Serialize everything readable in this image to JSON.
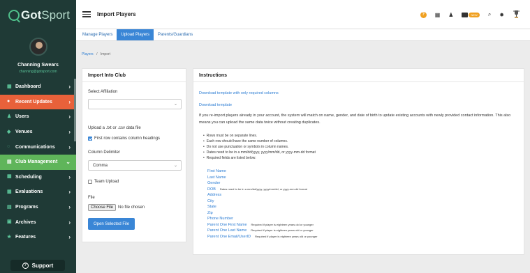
{
  "logo": {
    "part1": "Got",
    "part2": "Sport"
  },
  "user": {
    "name": "Channing Swears",
    "email": "channing@gotsport.com"
  },
  "nav": {
    "items": [
      {
        "label": "Dashboard",
        "icon": "dashboard-icon",
        "glyph": "▦"
      },
      {
        "label": "Recent Updates",
        "icon": "bell-icon",
        "glyph": "●"
      },
      {
        "label": "Users",
        "icon": "users-icon",
        "glyph": "♟"
      },
      {
        "label": "Venues",
        "icon": "venue-icon",
        "glyph": "◆"
      },
      {
        "label": "Communications",
        "icon": "chat-icon",
        "glyph": "◌"
      },
      {
        "label": "Club Management",
        "icon": "club-icon",
        "glyph": "▤"
      },
      {
        "label": "Scheduling",
        "icon": "calendar-icon",
        "glyph": "▦"
      },
      {
        "label": "Evaluations",
        "icon": "evaluation-icon",
        "glyph": "▦"
      },
      {
        "label": "Programs",
        "icon": "programs-icon",
        "glyph": "▤"
      },
      {
        "label": "Archives",
        "icon": "archive-icon",
        "glyph": "▣"
      },
      {
        "label": "Features",
        "icon": "star-icon",
        "glyph": "★"
      }
    ],
    "support_label": "Support"
  },
  "topbar": {
    "title": "Import Players",
    "badge_new": "NEW"
  },
  "tabs": [
    "Manage Players",
    "Upload Players",
    "Parents/Guardians"
  ],
  "breadcrumb": {
    "parent": "Players",
    "separator": "/",
    "current": "Import"
  },
  "left_panel": {
    "title": "Import Into Club",
    "affiliation_label": "Select Affiliation",
    "affiliation_value": "",
    "upload_label": "Upload a .txt or .csv data file",
    "first_row_label": "First row contains column headings",
    "delimiter_label": "Column Delimiter",
    "delimiter_value": "Comma",
    "team_upload_label": "Team Upload",
    "file_label": "File",
    "choose_file": "Choose File",
    "no_file": "No file chosen",
    "open_button": "Open Selected File"
  },
  "right_panel": {
    "title": "Instructions",
    "link1": "Download template with only required columns",
    "link2": "Download template",
    "paragraph": "If you re-import players already in your account, the system will match on name, gender, and date of birth to update existing accounts with newly provided contact information. This also means you can upload the same data twice without creating duplicates.",
    "bullets": [
      "Rows must be on separate lines.",
      "Each row should have the same number of columns.",
      "Do not use punctuation or symbols in column names.",
      "Dates need to be in a mm/dd/yyyy, yyyy/mm/dd, or yyyy-mm-dd format",
      "Required fields are listed below:"
    ],
    "required": [
      {
        "name": "First Name",
        "note": ""
      },
      {
        "name": "Last Name",
        "note": ""
      },
      {
        "name": "Gender",
        "note": ""
      },
      {
        "name": "DOB",
        "note": "Dates need to be in a mm/dd/yyyy, yyyy/mm/dd, or yyyy-mm-dd format"
      },
      {
        "name": "Address",
        "note": ""
      },
      {
        "name": "City",
        "note": ""
      },
      {
        "name": "State",
        "note": ""
      },
      {
        "name": "Zip",
        "note": ""
      },
      {
        "name": "Phone Number",
        "note": ""
      },
      {
        "name": "Parent One First Name",
        "note": "Required if player is eighteen years old or younger"
      },
      {
        "name": "Parent One Last Name",
        "note": "Required if player is eighteen years old or younger"
      },
      {
        "name": "Parent One Email/UserID",
        "note": "Required if player is eighteen years old or younger"
      }
    ]
  },
  "colors": {
    "sidebar": "#1f3a36",
    "accent": "#3a86d6",
    "updates": "#e8613a",
    "club": "#5fb55a",
    "badge": "#f0a020"
  }
}
